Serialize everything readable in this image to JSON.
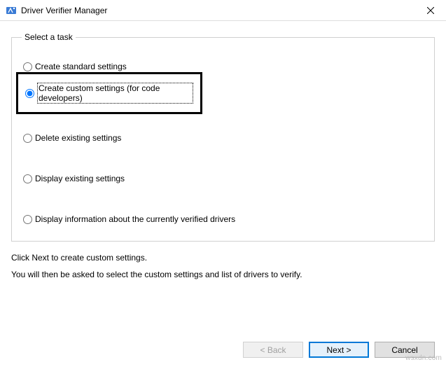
{
  "window": {
    "title": "Driver Verifier Manager"
  },
  "group": {
    "legend": "Select a task",
    "options": [
      {
        "label": "Create standard settings",
        "checked": false,
        "highlight": false,
        "focused": false
      },
      {
        "label": "Create custom settings (for code developers)",
        "checked": true,
        "highlight": true,
        "focused": true
      },
      {
        "label": "Delete existing settings",
        "checked": false,
        "highlight": false,
        "focused": false
      },
      {
        "label": "Display existing settings",
        "checked": false,
        "highlight": false,
        "focused": false
      },
      {
        "label": "Display information about the currently verified drivers",
        "checked": false,
        "highlight": false,
        "focused": false
      }
    ]
  },
  "hints": {
    "line1": "Click Next to create custom settings.",
    "line2": "You will then be asked to select the custom settings and list of drivers to verify."
  },
  "buttons": {
    "back": "< Back",
    "next": "Next >",
    "cancel": "Cancel"
  },
  "watermark": "wsxdn.com"
}
